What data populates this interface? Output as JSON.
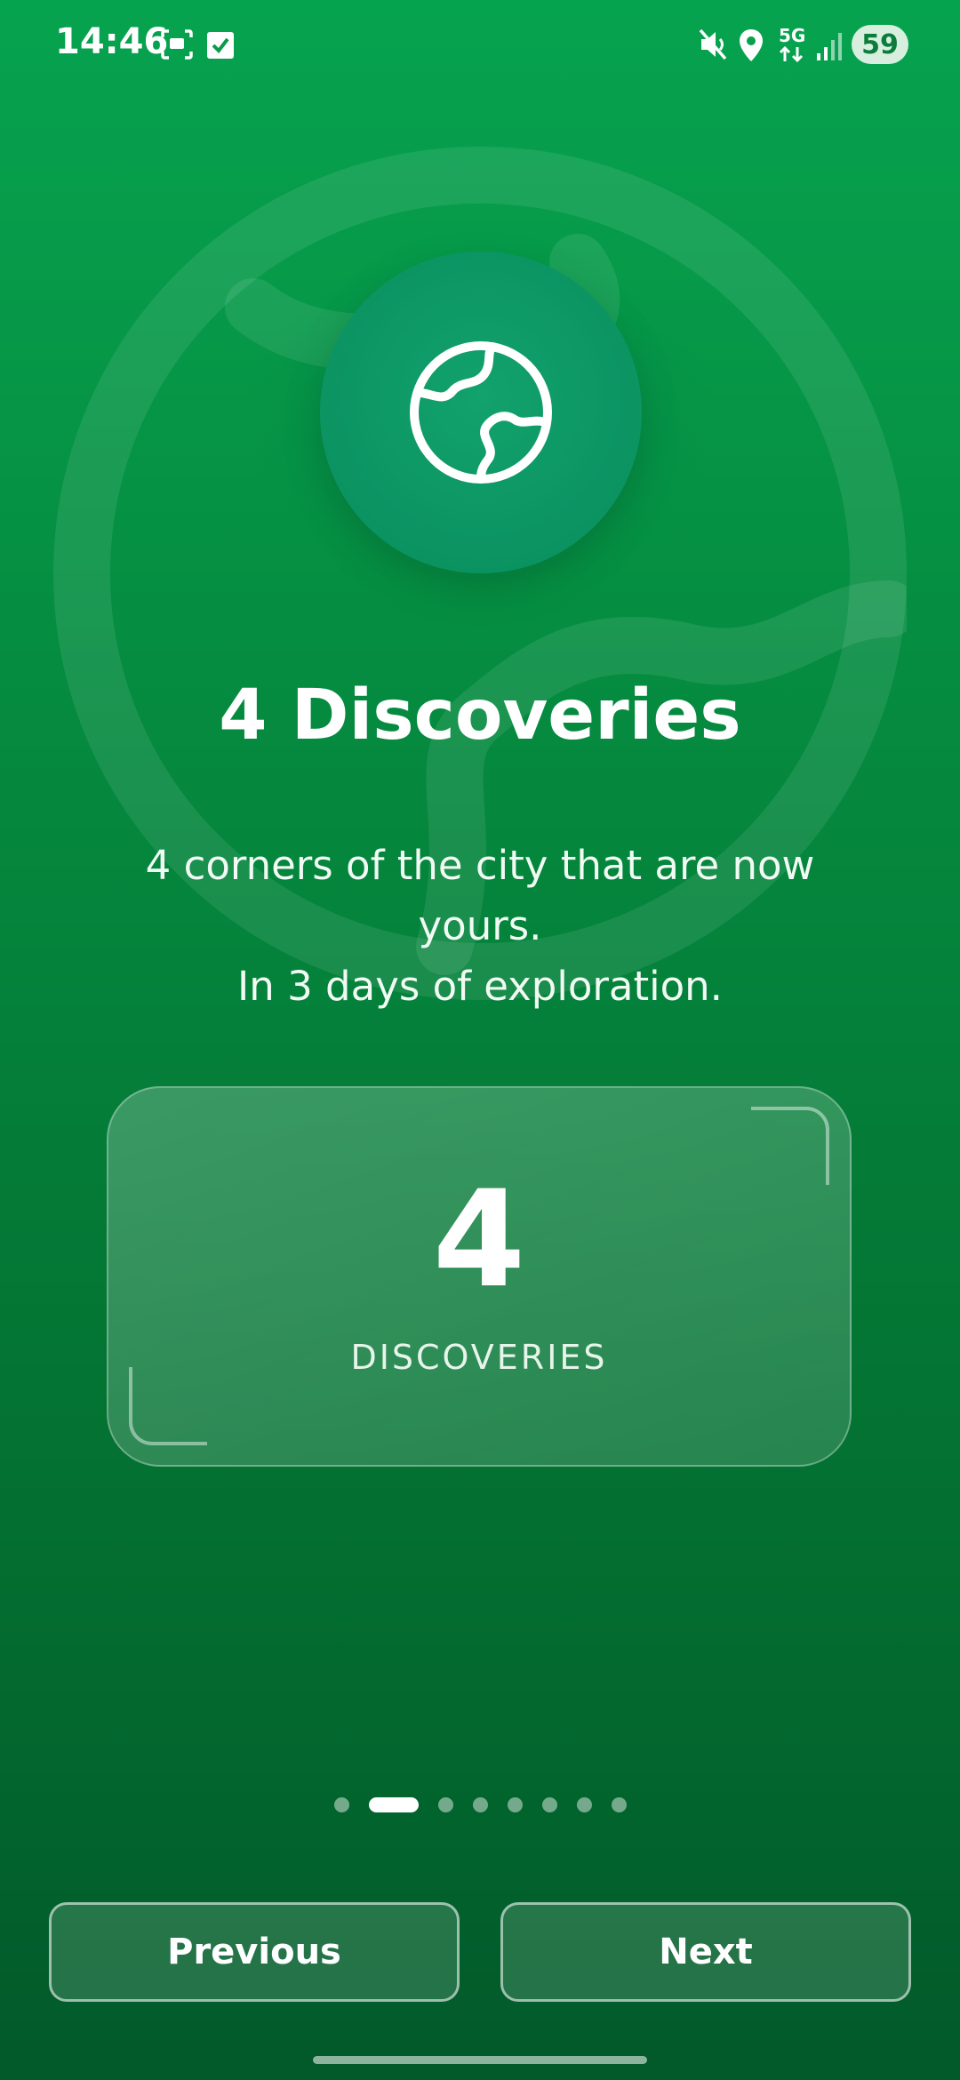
{
  "status_bar": {
    "time": "14:46",
    "network": "5G",
    "battery": "59",
    "icons": [
      "screenshot-icon",
      "checkbox-icon",
      "mute-icon",
      "location-icon",
      "signal-icon",
      "battery-icon"
    ]
  },
  "hero": {
    "icon": "globe-icon",
    "title": "4 Discoveries",
    "subtitle_lines": [
      "4 corners of the city that are now",
      "yours.",
      "In 3 days of exploration."
    ]
  },
  "stat_card": {
    "value": "4",
    "label": "DISCOVERIES"
  },
  "pagination": {
    "total": 8,
    "current_index": 1
  },
  "buttons": {
    "previous": "Previous",
    "next": "Next"
  },
  "colors": {
    "background_top": "#06a34f",
    "background_bottom": "#02592a",
    "badge": "#0c9664",
    "text": "#ffffff"
  }
}
